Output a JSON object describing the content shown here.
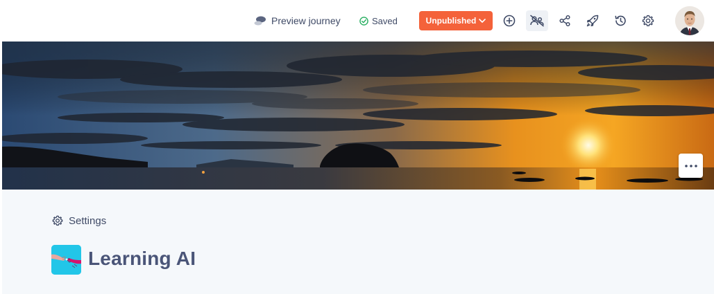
{
  "header": {
    "preview_label": "Preview journey",
    "saved_label": "Saved",
    "status_label": "Unpublished",
    "icons": [
      "add-icon",
      "hide-participants-icon",
      "share-icon",
      "launch-icon",
      "history-icon",
      "gear-icon"
    ]
  },
  "journey": {
    "settings_label": "Settings",
    "title": "Learning AI"
  },
  "colors": {
    "accent": "#f4623a",
    "saved_check": "#27ae60",
    "text": "#3f4a66",
    "content_bg": "#f5f8fb"
  }
}
